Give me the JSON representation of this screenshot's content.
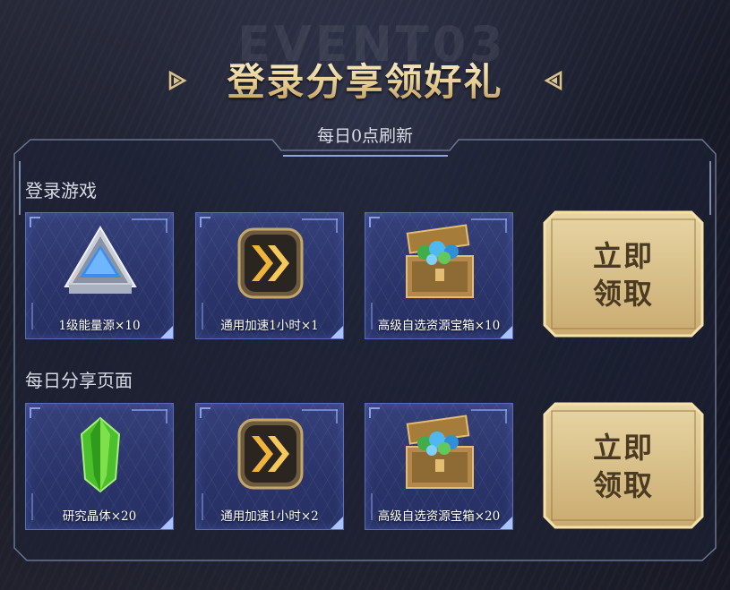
{
  "header": {
    "watermark": "EVENT03",
    "title": "登录分享领好礼",
    "subtitle": "每日0点刷新"
  },
  "sections": [
    {
      "label": "登录游戏",
      "items": [
        {
          "label": "1级能量源×10",
          "icon": "energy-source-icon"
        },
        {
          "label": "通用加速1小时×1",
          "icon": "speedup-icon"
        },
        {
          "label": "高级自选资源宝箱×10",
          "icon": "treasure-chest-icon"
        }
      ],
      "claim_label_1": "立即",
      "claim_label_2": "领取"
    },
    {
      "label": "每日分享页面",
      "items": [
        {
          "label": "研究晶体×20",
          "icon": "research-crystal-icon"
        },
        {
          "label": "通用加速1小时×2",
          "icon": "speedup-icon"
        },
        {
          "label": "高级自选资源宝箱×20",
          "icon": "treasure-chest-icon"
        }
      ],
      "claim_label_1": "立即",
      "claim_label_2": "领取"
    }
  ],
  "colors": {
    "gold": "#e7cf94",
    "item_bg": "#2b346a",
    "item_border": "#5a6cb6",
    "button_gold": "#d8c28e"
  }
}
